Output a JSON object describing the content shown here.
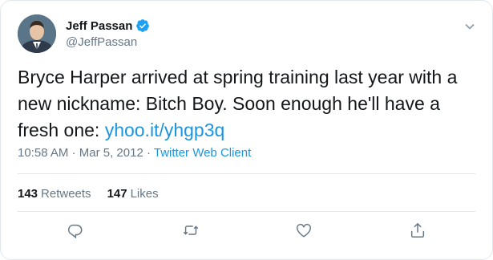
{
  "tweet": {
    "author_name": "Jeff Passan",
    "author_handle": "@JeffPassan",
    "text_main": "Bryce Harper arrived at spring training last year with a new nickname: Bitch Boy. Soon enough he'll have a fresh one:",
    "link_text": "yhoo.it/yhgp3q",
    "time": "10:58 AM",
    "date": "Mar 5, 2012",
    "separator": "·",
    "client": "Twitter Web Client"
  },
  "stats": {
    "retweets_count": "143",
    "retweets_label": "Retweets",
    "likes_count": "147",
    "likes_label": "Likes"
  },
  "icons": {
    "verified": "verified-badge-icon",
    "caret": "chevron-down-icon",
    "reply": "reply-icon",
    "retweet": "retweet-icon",
    "like": "heart-icon",
    "share": "share-icon"
  },
  "colors": {
    "link": "#1b95e0",
    "secondary_text": "#657786",
    "divider": "#e1e8ed"
  }
}
